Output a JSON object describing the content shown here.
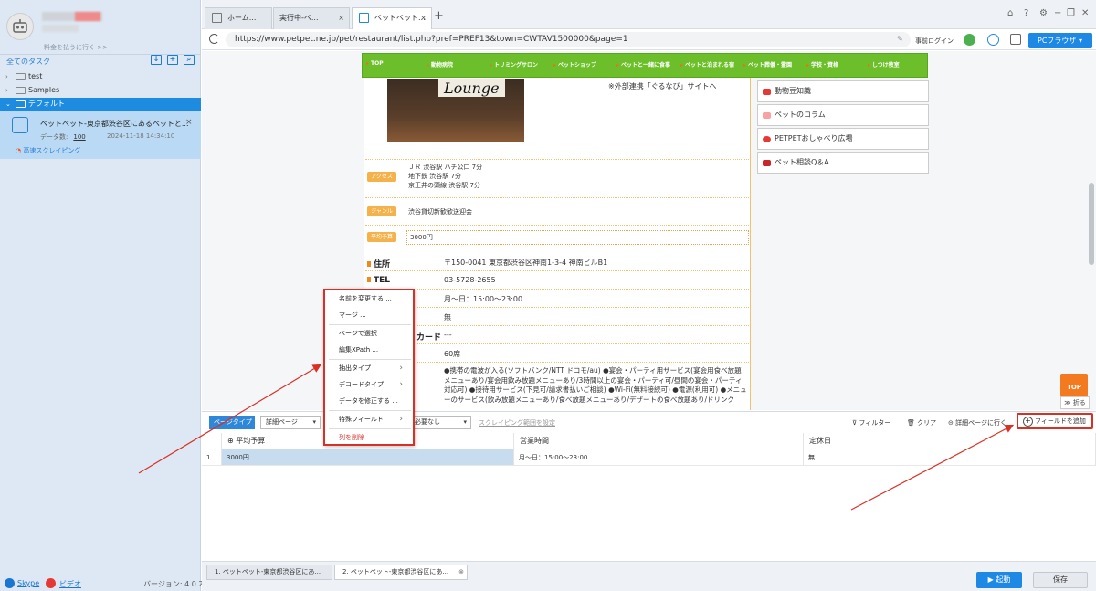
{
  "sidebar": {
    "pay_link": "料金を払うに行く >>",
    "all_tasks": "全てのタスク",
    "tree": [
      {
        "label": "test"
      },
      {
        "label": "Samples"
      },
      {
        "label": "デフォルト"
      }
    ],
    "task": {
      "name": "ペットペット-東京都渋谷区にあるペットと...",
      "data_label": "データ数:",
      "data_count": "100",
      "date": "2024-11-18 14:34:10",
      "speed": "高速スクレイピング"
    },
    "footer": {
      "skype": "Skype",
      "video": "ビデオ",
      "version": "バージョン: 4.0.2"
    }
  },
  "browser": {
    "tabs": [
      {
        "label": "ホーム..."
      },
      {
        "label": "実行中-ペ..."
      },
      {
        "label": "ペットペット..."
      }
    ],
    "url": "https://www.petpet.ne.jp/pet/restaurant/list.php?pref=PREF13&town=CWTAV1500000&page=1",
    "login": "事前ログイン",
    "pc_browser": "PCブラウザ"
  },
  "website": {
    "nav": [
      "TOP",
      "動物病院",
      "トリミングサロン",
      "ペットショップ",
      "ペットと一緒に食事",
      "ペットと泊まれる宿",
      "ペット葬儀・霊園",
      "学校・資格",
      "しつけ教室"
    ],
    "photo_sign": "Lounge",
    "gurunavi": "※外部連携「ぐるなび」サイトへ",
    "right_links": [
      "動物豆知識",
      "ペットのコラム",
      "PETPETおしゃべり広場",
      "ペット相談Q＆A"
    ],
    "access_label": "アクセス",
    "access_lines": [
      "ＪＲ 渋谷駅 ハチ公口 7分",
      "地下鉄 渋谷駅 7分",
      "京王井の頭線 渋谷駅 7分"
    ],
    "genre_label": "ジャンル",
    "genre": "渋谷貸切新歓歓送迎会",
    "budget_label": "平均予算",
    "budget": "3000円",
    "address_label": "住所",
    "address": "〒150-0041 東京都渋谷区神南1-3-4 神南ビルB1",
    "tel_label": "TEL",
    "tel": "03-5728-2655",
    "hours": "月～日：15:00～23:00",
    "holiday": "無",
    "card_label_tail": "カード",
    "card": "---",
    "seats": "60席",
    "facilities": "●携帯の電波が入る(ソフトバンク/NTT ドコモ/au) ●宴会・パーティ用サービス(宴会用食べ放題メニューあり/宴会用飲み放題メニューあり/3時間以上の宴会・パーティ可/昼間の宴会・パーティ対応可) ●接待用サービス(下見可/請求書払いご相談) ●Wi-Fi(無料接続可) ●電源(利用可) ●メニューのサービス(飲み放題メニューあり/食べ放題メニューあり/デザートの食べ放題あり/ドリンク",
    "top_btn": "TOP",
    "fold_btn": "折る"
  },
  "toolbar": {
    "page_type": "ページタイプ",
    "detail_page": "詳細ページ",
    "not_needed": "必要なし",
    "scrape_range": "スクレイピング範囲を設定",
    "filter": "フィルター",
    "clear": "クリア",
    "go_detail": "詳細ページに行く",
    "add_field": "フィールドを追加"
  },
  "grid": {
    "columns": [
      "平均予算",
      "営業時間",
      "定休日"
    ],
    "rows": [
      {
        "index": "1",
        "cells": [
          "3000円",
          "月～日：15:00～23:00",
          "無"
        ]
      }
    ]
  },
  "context_menu": {
    "items": [
      "名前を変更する ...",
      "マージ ...",
      "ページで選択",
      "編集XPath ...",
      "抽出タイプ",
      "デコードタイプ",
      "データを修正する ...",
      "特殊フィールド",
      "列を削除"
    ]
  },
  "bottom": {
    "tabs": [
      "1. ペットペット-東京都渋谷区にあ...",
      "2. ペットペット-東京都渋谷区にあ..."
    ],
    "start": "▶ 起動",
    "save": "保存"
  },
  "colors": {
    "accent": "#1e88e5",
    "nav_green": "#6cbf2a",
    "highlight_red": "#d93025",
    "orange": "#f47a20"
  }
}
